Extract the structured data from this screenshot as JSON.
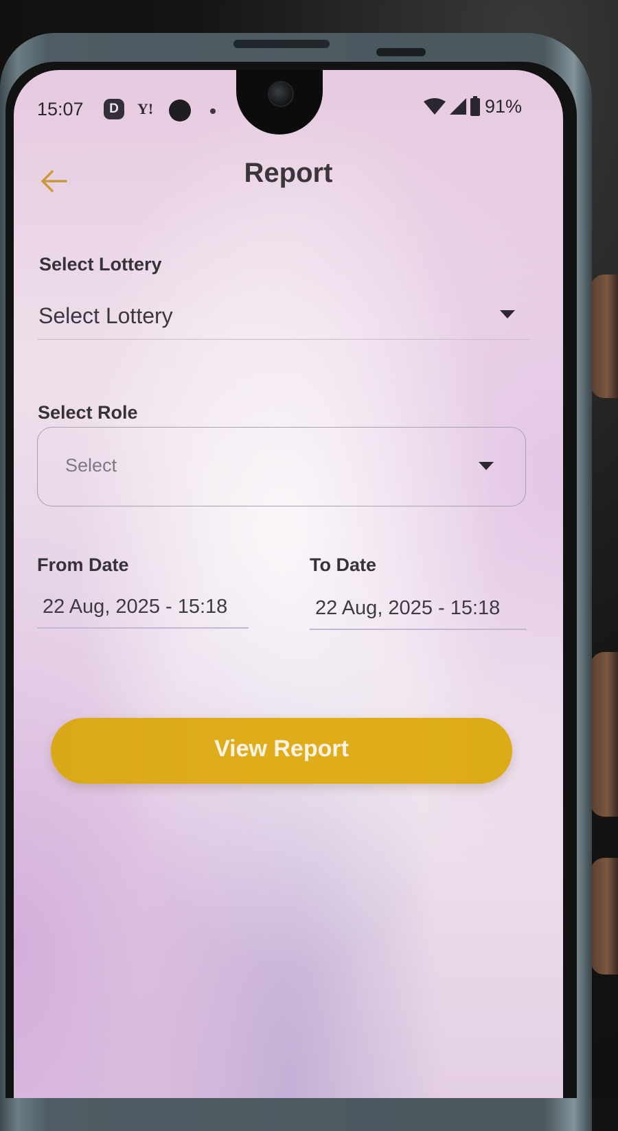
{
  "status_bar": {
    "time": "15:07",
    "notification_icons": [
      "d-app-icon",
      "yahoo-icon",
      "circle-icon",
      "dot-icon"
    ],
    "d_icon_letter": "D",
    "y_icon_letter": "Y!",
    "battery_percent": "91%"
  },
  "app_bar": {
    "title": "Report",
    "back_icon": "arrow-left-icon"
  },
  "form": {
    "lottery_label": "Select Lottery",
    "lottery_value": "Select Lottery",
    "role_label": "Select Role",
    "role_placeholder": "Select",
    "from_date_label": "From Date",
    "from_date_value": "22 Aug, 2025 - 15:18",
    "to_date_label": "To Date",
    "to_date_value": "22 Aug, 2025 - 15:18"
  },
  "actions": {
    "view_report_label": "View Report"
  },
  "colors": {
    "accent": "#dcab18",
    "back_arrow": "#c99a3c",
    "text_primary": "#36323a",
    "date_underline": "#c3b7d4"
  }
}
